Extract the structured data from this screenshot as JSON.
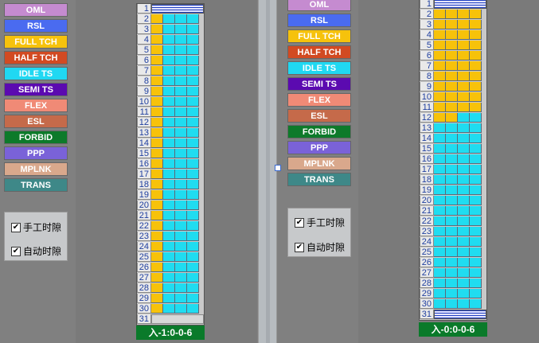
{
  "legend": [
    {
      "label": "OML",
      "color": "#c58bd0"
    },
    {
      "label": "RSL",
      "color": "#4a6bf0"
    },
    {
      "label": "FULL TCH",
      "color": "#f6c20c"
    },
    {
      "label": "HALF TCH",
      "color": "#d24a22"
    },
    {
      "label": "IDLE TS",
      "color": "#20d8f2"
    },
    {
      "label": "SEMI TS",
      "color": "#5b0ab0"
    },
    {
      "label": "FLEX",
      "color": "#f08a76"
    },
    {
      "label": "ESL",
      "color": "#c56a4a"
    },
    {
      "label": "FORBID",
      "color": "#0d7a2a"
    },
    {
      "label": "PPP",
      "color": "#7a62d8"
    },
    {
      "label": "MPLNK",
      "color": "#d9a88c"
    },
    {
      "label": "TRANS",
      "color": "#3e8888"
    }
  ],
  "checks": {
    "manual": {
      "label": "手工时隙",
      "checked": true,
      "mark": "✔"
    },
    "auto": {
      "label": "自动时隙",
      "checked": true,
      "mark": "✔"
    }
  },
  "left_grid": {
    "footer": "入-1:0-0-6",
    "row_numbers": [
      "1",
      "2",
      "3",
      "4",
      "5",
      "6",
      "7",
      "8",
      "9",
      "10",
      "11",
      "12",
      "13",
      "14",
      "15",
      "16",
      "17",
      "18",
      "19",
      "20",
      "21",
      "22",
      "23",
      "24",
      "25",
      "26",
      "27",
      "28",
      "29",
      "30",
      "31"
    ]
  },
  "right_grid": {
    "footer": "入-0:0-0-6",
    "row_numbers": [
      "1",
      "2",
      "3",
      "4",
      "5",
      "6",
      "7",
      "8",
      "9",
      "10",
      "11",
      "12",
      "13",
      "14",
      "15",
      "16",
      "17",
      "18",
      "19",
      "20",
      "21",
      "22",
      "23",
      "24",
      "25",
      "26",
      "27",
      "28",
      "29",
      "30",
      "31"
    ]
  }
}
